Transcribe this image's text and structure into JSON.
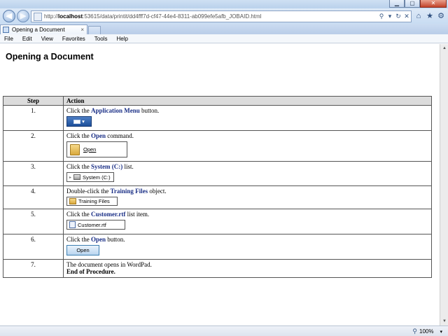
{
  "browser": {
    "url_prefix": "http://",
    "url_host": "localhost",
    "url_rest": ":53615/data/printit/dd4fff7d-cf47-44e4-8311-ab099efe5afb_JOBAID.html",
    "tab_title": "Opening a Document",
    "tab_close": "×",
    "menu": [
      "File",
      "Edit",
      "View",
      "Favorites",
      "Tools",
      "Help"
    ],
    "zoom": "100%",
    "icons": {
      "back": "back-arrow-icon",
      "forward": "forward-arrow-icon",
      "search": "search-icon",
      "refresh": "refresh-icon",
      "stop": "stop-icon",
      "home": "home-icon",
      "favorites": "star-icon",
      "tools": "gear-icon"
    }
  },
  "page": {
    "title": "Opening a Document",
    "table": {
      "headers": {
        "step": "Step",
        "action": "Action"
      },
      "rows": [
        {
          "step": "1.",
          "prefix": "Click the ",
          "ui": "Application Menu",
          "suffix": " button."
        },
        {
          "step": "2.",
          "prefix": "Click the ",
          "ui": "Open",
          "suffix": " command.",
          "shot_label": "Open"
        },
        {
          "step": "3.",
          "prefix": "Click the ",
          "ui": "System (C:)",
          "suffix": " list.",
          "shot_label": "System (C:)"
        },
        {
          "step": "4.",
          "prefix": "Double-click the ",
          "ui": "Training Files",
          "suffix": " object.",
          "shot_label": "Training Files"
        },
        {
          "step": "5.",
          "prefix": "Click the ",
          "ui": "Customer.rtf",
          "suffix": " list item.",
          "shot_label": "Customer.rtf"
        },
        {
          "step": "6.",
          "prefix": "Click the ",
          "ui": "Open",
          "suffix": " button.",
          "shot_label": "Open"
        },
        {
          "step": "7.",
          "text": "The document opens in WordPad.",
          "end": "End of Procedure."
        }
      ]
    }
  }
}
